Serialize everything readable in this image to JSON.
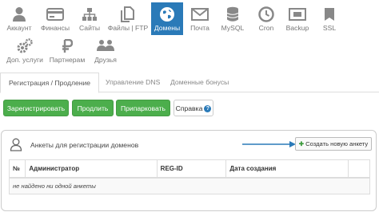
{
  "nav": {
    "items": [
      {
        "label": "Аккаунт",
        "icon": "user-icon"
      },
      {
        "label": "Финансы",
        "icon": "credit-card-icon"
      },
      {
        "label": "Сайты",
        "icon": "sitemap-icon"
      },
      {
        "label": "Файлы | FTP",
        "icon": "files-icon"
      },
      {
        "label": "Домены",
        "icon": "globe-icon",
        "active": true
      },
      {
        "label": "Почта",
        "icon": "envelope-icon"
      },
      {
        "label": "MySQL",
        "icon": "database-icon"
      },
      {
        "label": "Cron",
        "icon": "clock-icon"
      },
      {
        "label": "Backup",
        "icon": "backup-icon"
      },
      {
        "label": "SSL",
        "icon": "ssl-icon"
      },
      {
        "label": "Доп. услуги",
        "icon": "gears-icon"
      },
      {
        "label": "Партнерам",
        "icon": "ruble-icon"
      },
      {
        "label": "Друзья",
        "icon": "friends-icon"
      }
    ]
  },
  "tabs": [
    {
      "label": "Регистрация / Продление",
      "active": true
    },
    {
      "label": "Управление DNS"
    },
    {
      "label": "Доменные бонусы"
    }
  ],
  "actions": {
    "register": "Зарегистрировать",
    "renew": "Продлить",
    "park": "Припарковать",
    "help": "Справка"
  },
  "panel": {
    "title": "Анкеты для регистрации доменов",
    "create_button": "Создать новую анкету",
    "columns": [
      "№",
      "Администратор",
      "REG-ID",
      "Дата создания",
      ""
    ],
    "empty_message": "не найдено ни одной анкеты"
  },
  "colors": {
    "active_nav": "#2a7ab8",
    "green_button": "#4cae4c",
    "annotation_arrow": "#2a7ab8"
  }
}
